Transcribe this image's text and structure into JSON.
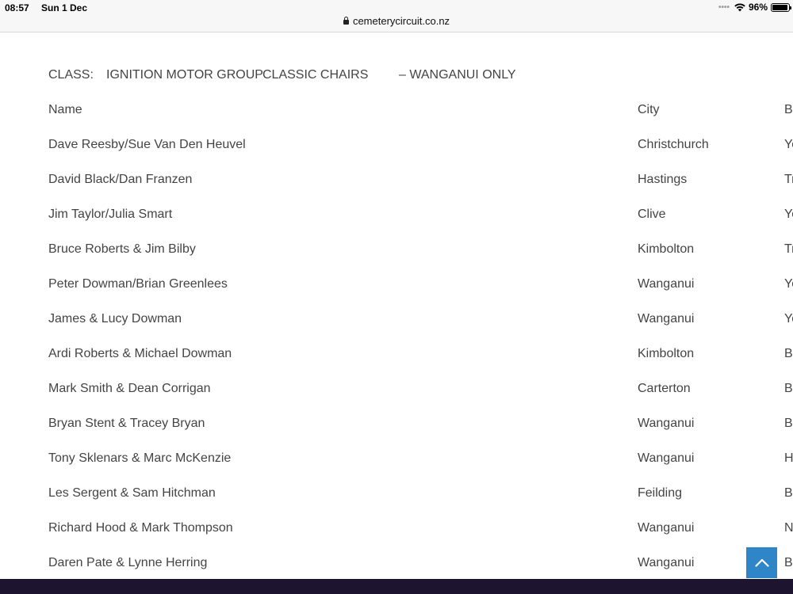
{
  "status": {
    "time": "08:57",
    "date": "Sun 1 Dec",
    "battery": "96%",
    "battery_level": 0.96
  },
  "browser": {
    "url": "cemeterycircuit.co.nz"
  },
  "class_line": {
    "prefix": "CLASS:",
    "sponsor": "IGNITION MOTOR GROUP",
    "name": "CLASSIC CHAIRS",
    "suffix": "– WANGANUI ONLY"
  },
  "table": {
    "headers": {
      "name": "Name",
      "city": "City",
      "third": "B"
    },
    "rows": [
      {
        "name": "Dave Reesby/Sue Van Den Heuvel",
        "city": "Christchurch",
        "third": "Yo"
      },
      {
        "name": "David Black/Dan Franzen",
        "city": "Hastings",
        "third": "Tr"
      },
      {
        "name": "Jim Taylor/Julia Smart",
        "city": "Clive",
        "third": "Yo"
      },
      {
        "name": "Bruce Roberts & Jim Bilby",
        "city": "Kimbolton",
        "third": "Tr"
      },
      {
        "name": "Peter Dowman/Brian Greenlees",
        "city": "Wanganui",
        "third": "Yo"
      },
      {
        "name": "James & Lucy Dowman",
        "city": "Wanganui",
        "third": "Yo"
      },
      {
        "name": "Ardi Roberts & Michael Dowman",
        "city": "Kimbolton",
        "third": "B"
      },
      {
        "name": "Mark Smith & Dean Corrigan",
        "city": "Carterton",
        "third": "B"
      },
      {
        "name": "Bryan Stent & Tracey Bryan",
        "city": "Wanganui",
        "third": "B"
      },
      {
        "name": "Tony Sklenars & Marc McKenzie",
        "city": "Wanganui",
        "third": "H"
      },
      {
        "name": "Les Sergent & Sam Hitchman",
        "city": "Feilding",
        "third": "B"
      },
      {
        "name": "Richard Hood & Mark Thompson",
        "city": "Wanganui",
        "third": "N"
      },
      {
        "name": "Daren Pate & Lynne Herring",
        "city": "Wanganui",
        "third": "B"
      }
    ]
  },
  "icons": {
    "scroll_top": "chevron-up-icon",
    "wifi": "wifi-icon",
    "lock": "lock-icon"
  },
  "colors": {
    "scroll_top_bg": "#2e86c9",
    "footer_bg": "#1d1530",
    "text": "#444444"
  }
}
